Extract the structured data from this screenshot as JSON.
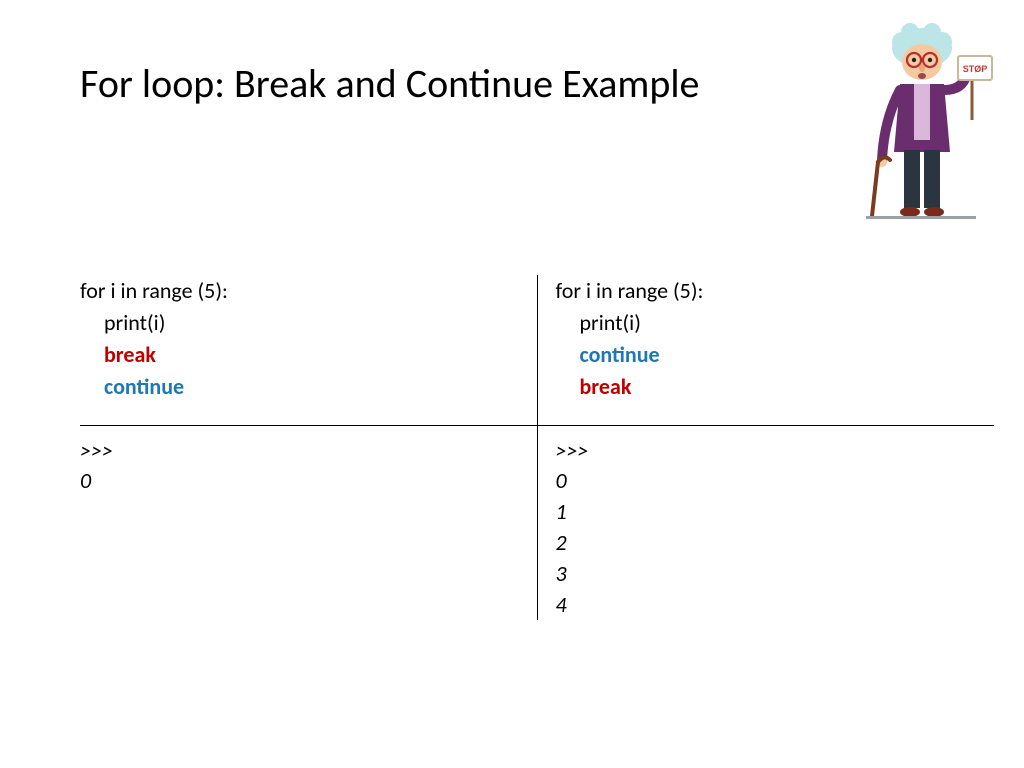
{
  "title": "For loop: Break and Continue Example",
  "left": {
    "code": {
      "line1": "for i in range (5):",
      "line2": "print(i)",
      "line3": "break",
      "line4": "continue"
    },
    "output": {
      "prompt": ">>>",
      "lines": [
        "0"
      ]
    }
  },
  "right": {
    "code": {
      "line1": "for i in range (5):",
      "line2": "print(i)",
      "line3": "continue",
      "line4": "break"
    },
    "output": {
      "prompt": ">>>",
      "lines": [
        "0",
        "1",
        "2",
        "3",
        "4"
      ]
    }
  },
  "illustration": {
    "sign": "STØP"
  },
  "colors": {
    "break": "#c00000",
    "continue": "#1f77b4"
  }
}
